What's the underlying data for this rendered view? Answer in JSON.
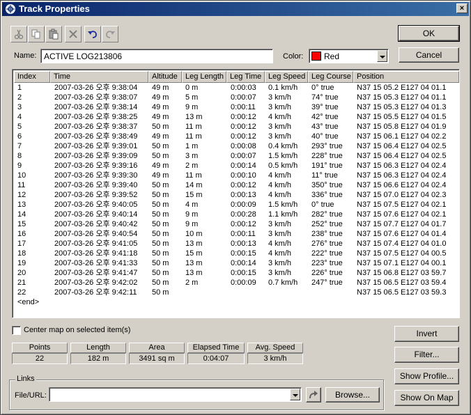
{
  "window": {
    "title": "Track Properties",
    "close_label": "×"
  },
  "toolbar": {
    "buttons": [
      "cut-icon",
      "copy-icon",
      "paste-icon",
      "delete-icon",
      "undo-icon",
      "redo-icon"
    ]
  },
  "name": {
    "label": "Name:",
    "value": "ACTIVE LOG213806"
  },
  "color": {
    "label": "Color:",
    "value": "Red",
    "swatch": "#ff0000"
  },
  "buttons": {
    "ok": "OK",
    "cancel": "Cancel",
    "invert": "Invert",
    "filter": "Filter...",
    "show_profile": "Show Profile...",
    "show_on_map": "Show On Map",
    "browse": "Browse..."
  },
  "columns": [
    "Index",
    "Time",
    "Altitude",
    "Leg Length",
    "Leg Time",
    "Leg Speed",
    "Leg Course",
    "Position"
  ],
  "rows": [
    [
      "1",
      "2007-03-26 오후 9:38:04",
      "49 m",
      "0 m",
      "0:00:03",
      "0.1 km/h",
      "0° true",
      "N37 15 05.2 E127 04 01.1"
    ],
    [
      "2",
      "2007-03-26 오후 9:38:07",
      "49 m",
      "5 m",
      "0:00:07",
      "3 km/h",
      "74° true",
      "N37 15 05.3 E127 04 01.1"
    ],
    [
      "3",
      "2007-03-26 오후 9:38:14",
      "49 m",
      "9 m",
      "0:00:11",
      "3 km/h",
      "39° true",
      "N37 15 05.3 E127 04 01.3"
    ],
    [
      "4",
      "2007-03-26 오후 9:38:25",
      "49 m",
      "13 m",
      "0:00:12",
      "4 km/h",
      "42° true",
      "N37 15 05.5 E127 04 01.5"
    ],
    [
      "5",
      "2007-03-26 오후 9:38:37",
      "50 m",
      "11 m",
      "0:00:12",
      "3 km/h",
      "43° true",
      "N37 15 05.8 E127 04 01.9"
    ],
    [
      "6",
      "2007-03-26 오후 9:38:49",
      "49 m",
      "11 m",
      "0:00:12",
      "3 km/h",
      "40° true",
      "N37 15 06.1 E127 04 02.2"
    ],
    [
      "7",
      "2007-03-26 오후 9:39:01",
      "50 m",
      "1 m",
      "0:00:08",
      "0.4 km/h",
      "293° true",
      "N37 15 06.4 E127 04 02.5"
    ],
    [
      "8",
      "2007-03-26 오후 9:39:09",
      "50 m",
      "3 m",
      "0:00:07",
      "1.5 km/h",
      "228° true",
      "N37 15 06.4 E127 04 02.5"
    ],
    [
      "9",
      "2007-03-26 오후 9:39:16",
      "49 m",
      "2 m",
      "0:00:14",
      "0.5 km/h",
      "191° true",
      "N37 15 06.3 E127 04 02.4"
    ],
    [
      "10",
      "2007-03-26 오후 9:39:30",
      "49 m",
      "11 m",
      "0:00:10",
      "4 km/h",
      "11° true",
      "N37 15 06.3 E127 04 02.4"
    ],
    [
      "11",
      "2007-03-26 오후 9:39:40",
      "50 m",
      "14 m",
      "0:00:12",
      "4 km/h",
      "350° true",
      "N37 15 06.6 E127 04 02.4"
    ],
    [
      "12",
      "2007-03-26 오후 9:39:52",
      "50 m",
      "15 m",
      "0:00:13",
      "4 km/h",
      "336° true",
      "N37 15 07.0 E127 04 02.3"
    ],
    [
      "13",
      "2007-03-26 오후 9:40:05",
      "50 m",
      "4 m",
      "0:00:09",
      "1.5 km/h",
      "0° true",
      "N37 15 07.5 E127 04 02.1"
    ],
    [
      "14",
      "2007-03-26 오후 9:40:14",
      "50 m",
      "9 m",
      "0:00:28",
      "1.1 km/h",
      "282° true",
      "N37 15 07.6 E127 04 02.1"
    ],
    [
      "15",
      "2007-03-26 오후 9:40:42",
      "50 m",
      "9 m",
      "0:00:12",
      "3 km/h",
      "252° true",
      "N37 15 07.7 E127 04 01.7"
    ],
    [
      "16",
      "2007-03-26 오후 9:40:54",
      "50 m",
      "10 m",
      "0:00:11",
      "3 km/h",
      "238° true",
      "N37 15 07.6 E127 04 01.4"
    ],
    [
      "17",
      "2007-03-26 오후 9:41:05",
      "50 m",
      "13 m",
      "0:00:13",
      "4 km/h",
      "276° true",
      "N37 15 07.4 E127 04 01.0"
    ],
    [
      "18",
      "2007-03-26 오후 9:41:18",
      "50 m",
      "15 m",
      "0:00:15",
      "4 km/h",
      "222° true",
      "N37 15 07.5 E127 04 00.5"
    ],
    [
      "19",
      "2007-03-26 오후 9:41:33",
      "50 m",
      "13 m",
      "0:00:14",
      "3 km/h",
      "223° true",
      "N37 15 07.1 E127 04 00.1"
    ],
    [
      "20",
      "2007-03-26 오후 9:41:47",
      "50 m",
      "13 m",
      "0:00:15",
      "3 km/h",
      "226° true",
      "N37 15 06.8 E127 03 59.7"
    ],
    [
      "21",
      "2007-03-26 오후 9:42:02",
      "50 m",
      "2 m",
      "0:00:09",
      "0.7 km/h",
      "247° true",
      "N37 15 06.5 E127 03 59.4"
    ],
    [
      "22",
      "2007-03-26 오후 9:42:11",
      "50 m",
      "",
      "",
      "",
      "",
      "N37 15 06.5 E127 03 59.3"
    ]
  ],
  "end_marker": "<end>",
  "center_map": {
    "label": "Center map on selected item(s)",
    "checked": false
  },
  "stats": {
    "headers": [
      "Points",
      "Length",
      "Area",
      "Elapsed Time",
      "Avg. Speed"
    ],
    "values": [
      "22",
      "182 m",
      "3491 sq m",
      "0:04:07",
      "3 km/h"
    ]
  },
  "links": {
    "group_label": "Links",
    "file_label": "File/URL:",
    "value": ""
  }
}
